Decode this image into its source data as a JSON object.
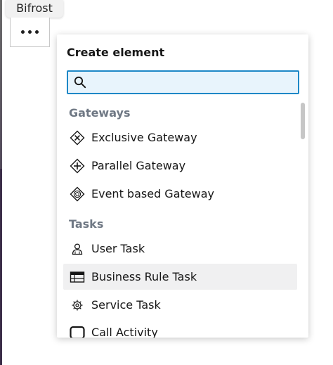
{
  "tab": {
    "label": "Bifrost"
  },
  "popup": {
    "title": "Create element",
    "search": {
      "value": "",
      "placeholder": ""
    },
    "groups": [
      {
        "name": "Gateways",
        "entries": [
          {
            "label": "Exclusive Gateway",
            "icon": "exclusive-gateway-icon"
          },
          {
            "label": "Parallel Gateway",
            "icon": "parallel-gateway-icon"
          },
          {
            "label": "Event based Gateway",
            "icon": "event-based-gateway-icon"
          }
        ]
      },
      {
        "name": "Tasks",
        "entries": [
          {
            "label": "User Task",
            "icon": "user-task-icon"
          },
          {
            "label": "Business Rule Task",
            "icon": "business-rule-task-icon"
          },
          {
            "label": "Service Task",
            "icon": "service-task-icon"
          },
          {
            "label": "Call Activity",
            "icon": "call-activity-icon"
          }
        ]
      }
    ]
  },
  "colors": {
    "accent": "#1e88c7",
    "search_bg": "#e8f4fc",
    "group_header": "#6f7884",
    "hover_bg": "#f0f0f1"
  }
}
